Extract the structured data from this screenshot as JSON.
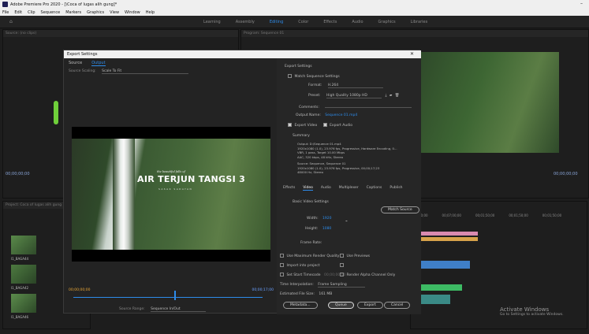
{
  "window": {
    "title": "Adobe Premiere Pro 2020 - [\\Coca of lugas alih gung]*"
  },
  "menu": [
    "File",
    "Edit",
    "Clip",
    "Sequence",
    "Markers",
    "Graphics",
    "View",
    "Window",
    "Help"
  ],
  "workspaces": [
    "Learning",
    "Assembly",
    "Editing",
    "Color",
    "Effects",
    "Audio",
    "Graphics",
    "Libraries"
  ],
  "left_panel": {
    "title": "Source: (no clips)",
    "timecode": "00;00;00;00"
  },
  "project": {
    "title": "Project: Coca of lugas alih gung",
    "clips": [
      "I1_BAGA44",
      "I1_BAGA42",
      "I1_BAGA46"
    ]
  },
  "program": {
    "title": "Program: Sequence 01",
    "timecode": "00;00;00;00"
  },
  "dialog": {
    "title": "Export Settings",
    "tabs": [
      "Source",
      "Output"
    ],
    "source_scaling_label": "Source Scaling:",
    "source_scaling": "Scale To Fit",
    "preview": {
      "small": "the beautiful falls of",
      "title": "AIR TERJUN TANGSI 3",
      "subtitle": "SASAK SADAYAN"
    },
    "tc_left": "00;00;00;00",
    "tc_right": "00;00;17;00",
    "source_range_label": "Source Range:",
    "source_range": "Sequence In/Out",
    "export": {
      "header": "Export Settings",
      "match": "Match Sequence Settings",
      "format_label": "Format:",
      "format": "H.264",
      "preset_label": "Preset:",
      "preset": "High Quality 1080p HD",
      "comments_label": "Comments:",
      "output_label": "Output Name:",
      "output": "Sequence 01.mp4",
      "export_video": "Export Video",
      "export_audio": "Export Audio",
      "summary": "Summary",
      "output_summary": "Output: D:\\Sequence 01.mp4\n1920x1080 (1.0), 23.976 fps, Progressive, Hardware Encoding, 0...\nVBR, 1 pass, Target 10.00 Mbps\nAAC, 320 kbps, 48 kHz, Stereo",
      "source_summary": "Source: Sequence, Sequence 01\n1920x1080 (1.0), 23.976 fps, Progressive, 00;00;17;23\n48000 Hz, Stereo"
    },
    "video_tabs": [
      "Effects",
      "Video",
      "Audio",
      "Multiplexer",
      "Captions",
      "Publish"
    ],
    "basic": {
      "header": "Basic Video Settings",
      "match_source": "Match Source",
      "width_label": "Width:",
      "width": "1920",
      "height_label": "Height:",
      "height": "1080",
      "frame_rate": "Frame Rate:"
    },
    "options": {
      "max_render": "Use Maximum Render Quality",
      "use_previews": "Use Previews",
      "import": "Import into project",
      "set_start": "Set Start Timecode",
      "start_tc": "00;00;00;00",
      "render_alpha": "Render Alpha Channel Only",
      "interp_label": "Time Interpolation:",
      "interp": "Frame Sampling",
      "size_label": "Estimated File Size:",
      "size": "161 MB"
    },
    "buttons": {
      "metadata": "Metadata...",
      "queue": "Queue",
      "export": "Export",
      "cancel": "Cancel"
    }
  },
  "timeline": {
    "ticks": [
      "00;00",
      "00;07;00;00",
      "00;01;50;00",
      "00;01;50;00",
      "00;01;50;00"
    ]
  },
  "activation": {
    "title": "Activate Windows",
    "sub": "Go to Settings to activate Windows."
  },
  "colors": {
    "accent": "#2d8ceb",
    "timecode": "#e8a637",
    "clip_pink": "#d88ab0",
    "clip_teal": "#3a8a86",
    "clip_green": "#3dbb64",
    "clip_blue": "#3f7fc7"
  }
}
